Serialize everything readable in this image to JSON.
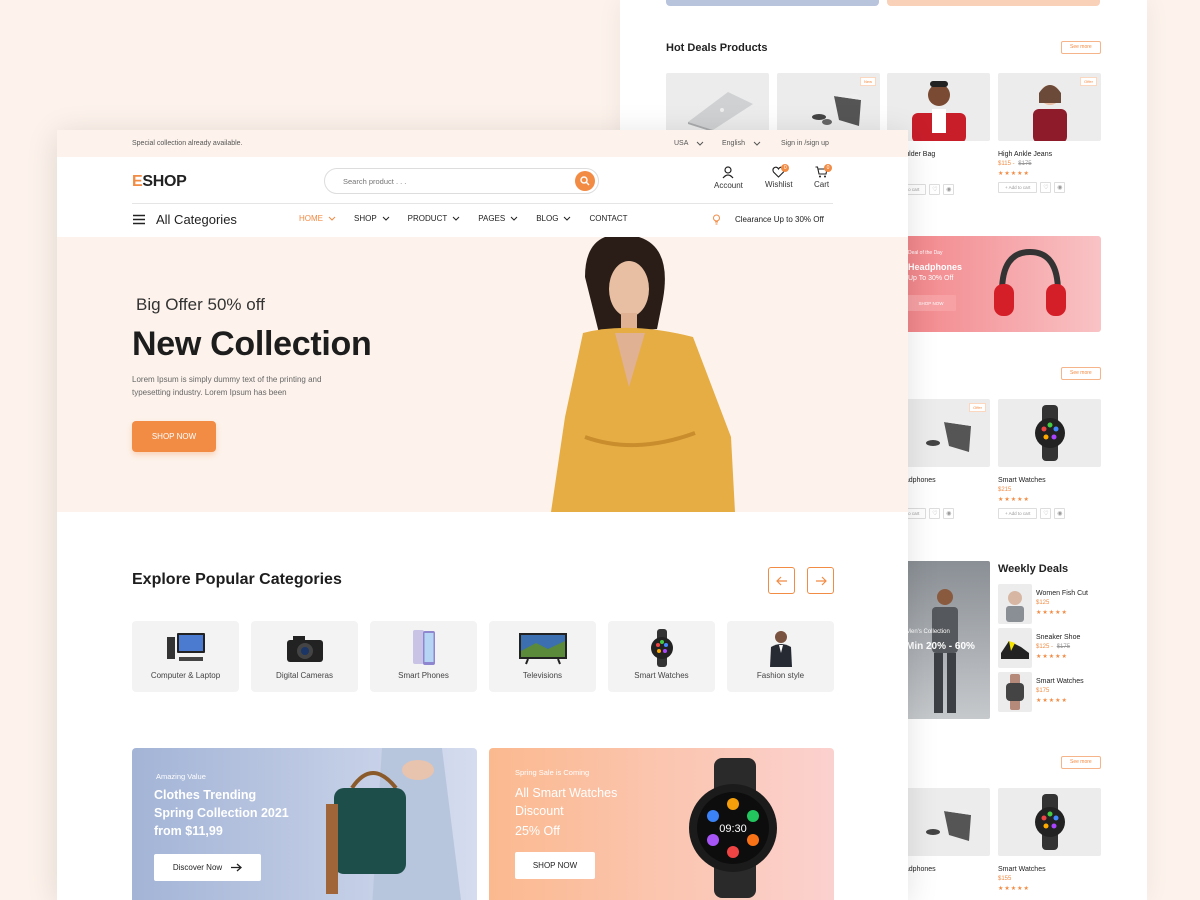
{
  "back": {
    "hot_deals_title": "Hot Deals Products",
    "see_more": "See more",
    "offer_tag": "Offer",
    "new_tag": "New",
    "add_to_cart": "+ Add to cart",
    "hot_products": [
      {
        "name": "",
        "price": "",
        "old": ""
      },
      {
        "name": "",
        "price": "",
        "old": ""
      },
      {
        "name": "d Shoulder Bag",
        "price": "",
        "old": ""
      },
      {
        "name": "High Ankle Jeans",
        "price": "$115",
        "old": "$175"
      }
    ],
    "deal": {
      "small": "Deal of the Day",
      "title": "Headphones",
      "sub": "Up To 30% Off",
      "btn": "SHOP NOW"
    },
    "row2": [
      {
        "name": "ss Headphones",
        "price": "76"
      },
      {
        "name": "Smart Watches",
        "price": "$215"
      }
    ],
    "mens": {
      "small": "Men's Collection",
      "big": "Min 20% - 60%"
    },
    "weekly_title": "Weekly Deals",
    "weekly": [
      {
        "name": "Women Fish Cut",
        "price": "$125",
        "old": ""
      },
      {
        "name": "Sneaker Shoe",
        "price": "$125",
        "old": "$175"
      },
      {
        "name": "Smart Watches",
        "price": "$175",
        "old": ""
      }
    ],
    "row3": [
      {
        "name": "ss Headphones",
        "price": ""
      },
      {
        "name": "Smart Watches",
        "price": "$155"
      }
    ],
    "stars": "★★★★★",
    "stars_partial": "★★"
  },
  "topbar": {
    "announcement": "Special collection already available.",
    "country": "USA",
    "language": "English",
    "signin": "Sign in /sign up"
  },
  "header": {
    "logo_e": "E",
    "logo_rest": "SHOP",
    "search_placeholder": "Search product . . .",
    "account": "Account",
    "wishlist": "Wishlist",
    "cart": "Cart",
    "wishlist_count": "0",
    "cart_count": "0"
  },
  "nav": {
    "all_categories": "All Categories",
    "items": [
      "HOME",
      "SHOP",
      "PRODUCT",
      "PAGES",
      "BLOG",
      "CONTACT"
    ],
    "clearance": "Clearance Up to 30% Off"
  },
  "hero": {
    "subtitle": "Big Offer 50% off",
    "title": "New Collection",
    "description": "Lorem Ipsum is simply dummy text of the printing and typesetting industry. Lorem Ipsum has been",
    "button": "SHOP NOW"
  },
  "explore": {
    "title": "Explore Popular Categories",
    "categories": [
      "Computer & Laptop",
      "Digital Cameras",
      "Smart Phones",
      "Televisions",
      "Smart Watches",
      "Fashion style"
    ]
  },
  "promos": [
    {
      "small": "Amazing Value",
      "line1": "Clothes Trending",
      "line2": "Spring Collection 2021",
      "line3": "from $11,99",
      "button": "Discover Now"
    },
    {
      "small": "Spring Sale is Coming",
      "line1": "All Smart Watches",
      "line2": "Discount",
      "line3": "25% Off",
      "button": "SHOP NOW",
      "watch_time": "09:30"
    }
  ],
  "colors": {
    "accent": "#f28b44",
    "hero_bg": "#fdf3ec"
  }
}
